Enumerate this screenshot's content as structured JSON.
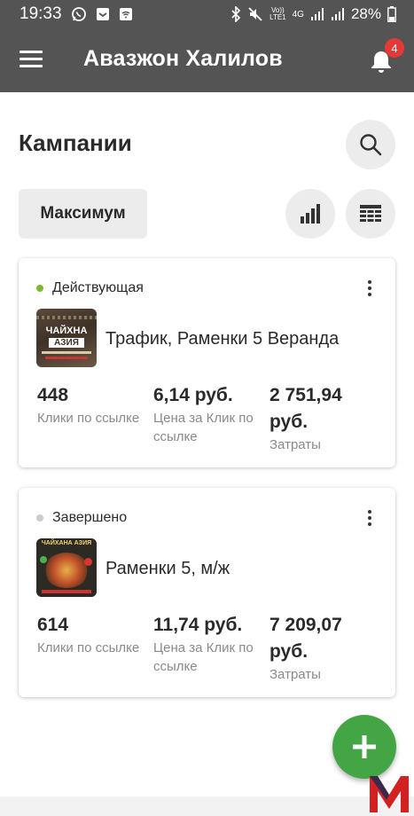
{
  "status_bar": {
    "time": "19:33",
    "volte_top": "Vo))",
    "volte_bottom": "LTE1",
    "net_type": "4G",
    "battery": "28%"
  },
  "app_bar": {
    "title": "Авазжон Халилов",
    "notification_count": "4"
  },
  "page": {
    "title": "Кампании",
    "filter_label": "Максимум"
  },
  "campaigns": [
    {
      "status": "Действующая",
      "status_color": "#7cb82f",
      "thumb_lines": [
        "ЧАЙХНА",
        "АЗИЯ"
      ],
      "name": "Трафик, Раменки 5 Веранда",
      "clicks": "448",
      "clicks_label": "Клики по ссылке",
      "cpc": "6,14 руб.",
      "cpc_label": "Цена за Клик по ссылке",
      "spent": "2 751,94 руб.",
      "spent_label": "Затраты"
    },
    {
      "status": "Завершено",
      "status_color": "#cccccc",
      "thumb_lines": [
        "ЧАЙХАНА АЗИЯ"
      ],
      "name": "Раменки 5, м/ж",
      "clicks": "614",
      "clicks_label": "Клики по ссылке",
      "cpc": "11,74 руб.",
      "cpc_label": "Цена за Клик по ссылке",
      "spent": "7 209,07 руб.",
      "spent_label": "Затраты"
    }
  ],
  "colors": {
    "app_bar": "#545454",
    "fab": "#43a543",
    "badge": "#e53935",
    "watermark": "#d32020"
  }
}
